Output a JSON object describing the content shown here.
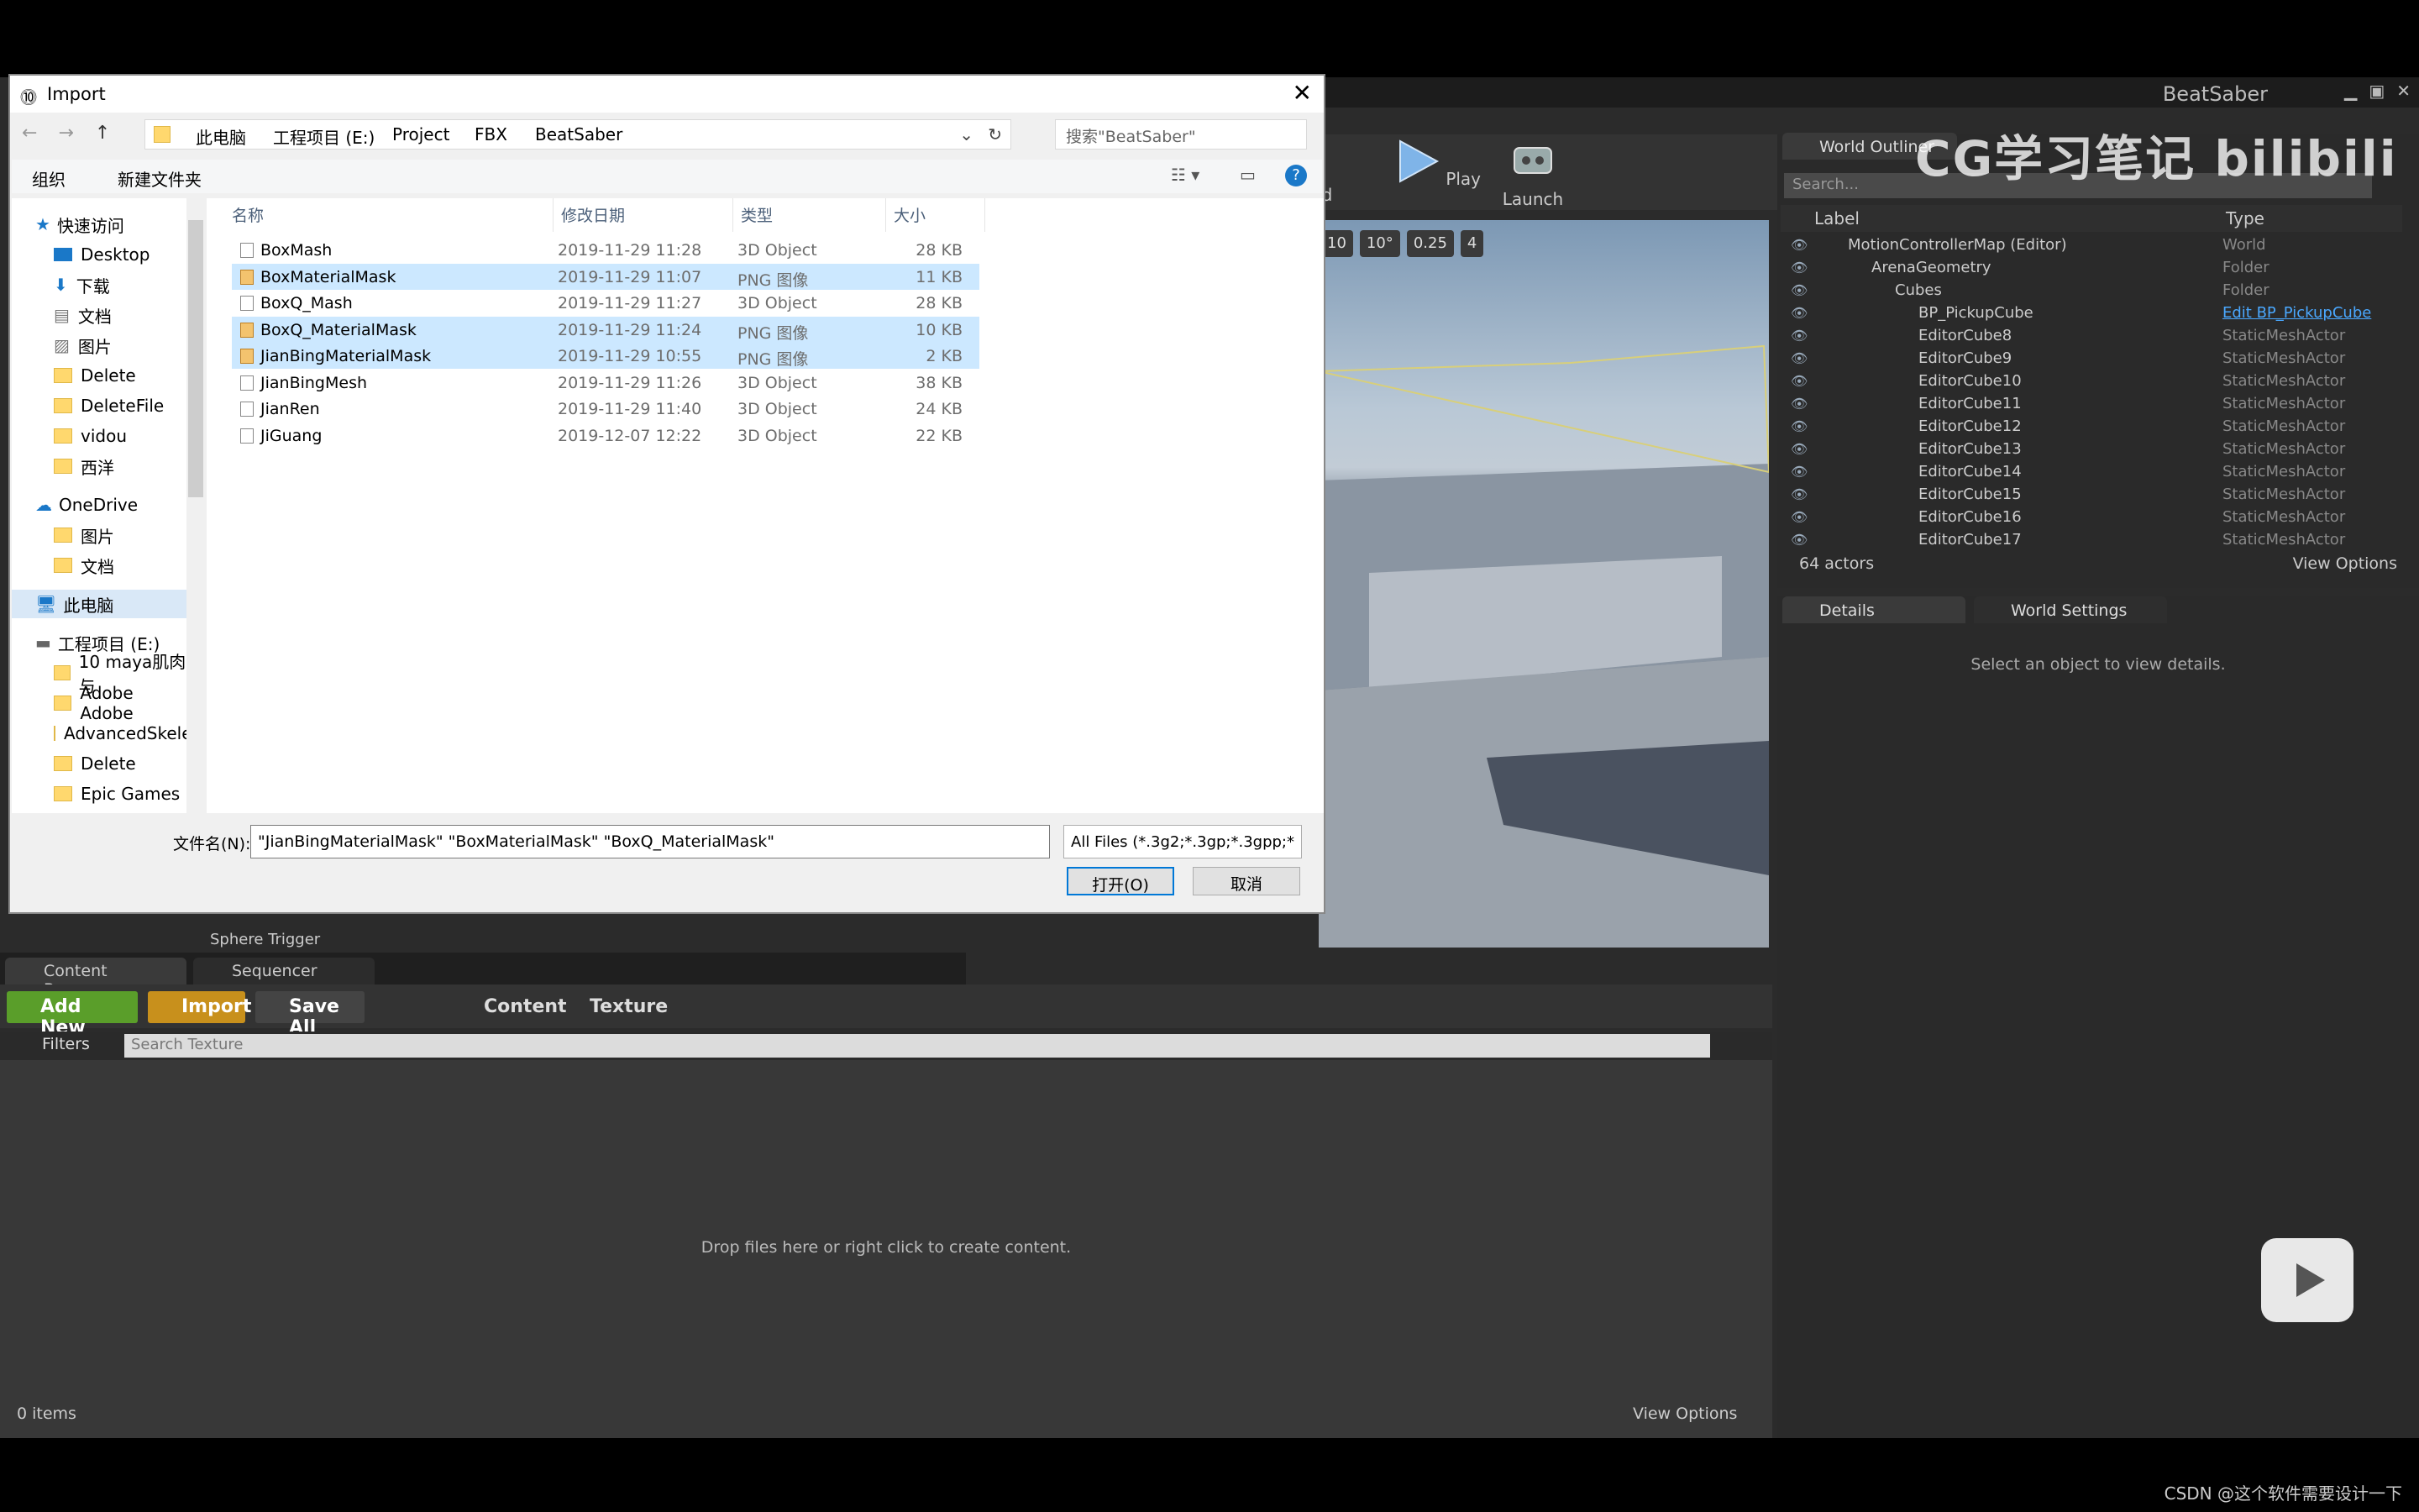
{
  "ue": {
    "project": "BeatSaber",
    "toolbar": {
      "play": "Play",
      "launch": "Launch",
      "partial": "d"
    },
    "viewport_chips": [
      "10",
      "10°",
      "0.25",
      "4"
    ],
    "outliner": {
      "tab": "World Outliner",
      "search_placeholder": "Search...",
      "col_label": "Label",
      "col_type": "Type",
      "rows": [
        {
          "label": "MotionControllerMap (Editor)",
          "type": "World",
          "indent": 0
        },
        {
          "label": "ArenaGeometry",
          "type": "Folder",
          "indent": 1
        },
        {
          "label": "Cubes",
          "type": "Folder",
          "indent": 2
        },
        {
          "label": "BP_PickupCube",
          "type": "Edit BP_PickupCube",
          "indent": 3,
          "link": true
        },
        {
          "label": "EditorCube8",
          "type": "StaticMeshActor",
          "indent": 3
        },
        {
          "label": "EditorCube9",
          "type": "StaticMeshActor",
          "indent": 3
        },
        {
          "label": "EditorCube10",
          "type": "StaticMeshActor",
          "indent": 3
        },
        {
          "label": "EditorCube11",
          "type": "StaticMeshActor",
          "indent": 3
        },
        {
          "label": "EditorCube12",
          "type": "StaticMeshActor",
          "indent": 3
        },
        {
          "label": "EditorCube13",
          "type": "StaticMeshActor",
          "indent": 3
        },
        {
          "label": "EditorCube14",
          "type": "StaticMeshActor",
          "indent": 3
        },
        {
          "label": "EditorCube15",
          "type": "StaticMeshActor",
          "indent": 3
        },
        {
          "label": "EditorCube16",
          "type": "StaticMeshActor",
          "indent": 3
        },
        {
          "label": "EditorCube17",
          "type": "StaticMeshActor",
          "indent": 3
        }
      ],
      "actor_count": "64 actors",
      "view_options": "View Options"
    },
    "details": {
      "tab": "Details",
      "tab2": "World Settings",
      "empty": "Select an object to view details."
    },
    "content_browser": {
      "tab": "Content Browser",
      "tab2": "Sequencer",
      "add_new": "Add New",
      "import": "Import",
      "save_all": "Save All",
      "crumbs": [
        "Content",
        "Texture"
      ],
      "filters": "Filters",
      "search_placeholder": "Search Texture",
      "drop_text": "Drop files here or right click to create content.",
      "items": "0 items",
      "view_options": "View Options",
      "partial_asset": "Sphere Trigger"
    }
  },
  "dialog": {
    "title": "Import",
    "path": [
      "此电脑",
      "工程项目 (E:)",
      "Project",
      "FBX",
      "BeatSaber"
    ],
    "search_placeholder": "搜索\"BeatSaber\"",
    "organize": "组织",
    "new_folder": "新建文件夹",
    "nav": [
      {
        "label": "快速访问",
        "type": "star"
      },
      {
        "label": "Desktop",
        "type": "desk"
      },
      {
        "label": "下载",
        "type": "down"
      },
      {
        "label": "文档",
        "type": "doc"
      },
      {
        "label": "图片",
        "type": "pic"
      },
      {
        "label": "Delete",
        "type": "folder"
      },
      {
        "label": "DeleteFile",
        "type": "folder"
      },
      {
        "label": "vidou",
        "type": "folder"
      },
      {
        "label": "西洋",
        "type": "folder"
      },
      {
        "label": "OneDrive",
        "type": "cloud"
      },
      {
        "label": "图片",
        "type": "folder"
      },
      {
        "label": "文档",
        "type": "folder"
      },
      {
        "label": "此电脑",
        "type": "pc"
      },
      {
        "label": "工程项目 (E:)",
        "type": "drive"
      },
      {
        "label": "10 maya肌肉与",
        "type": "folder"
      },
      {
        "label": "Adobe Adobe",
        "type": "folder"
      },
      {
        "label": "AdvancedSkele",
        "type": "folder"
      },
      {
        "label": "Delete",
        "type": "folder"
      },
      {
        "label": "Epic Games",
        "type": "folder"
      }
    ],
    "columns": {
      "name": "名称",
      "date": "修改日期",
      "type": "类型",
      "size": "大小"
    },
    "files": [
      {
        "name": "BoxMash",
        "date": "2019-11-29 11:28",
        "type": "3D Object",
        "size": "28 KB",
        "png": false,
        "selected": false
      },
      {
        "name": "BoxMaterialMask",
        "date": "2019-11-29 11:07",
        "type": "PNG 图像",
        "size": "11 KB",
        "png": true,
        "selected": true
      },
      {
        "name": "BoxQ_Mash",
        "date": "2019-11-29 11:27",
        "type": "3D Object",
        "size": "28 KB",
        "png": false,
        "selected": false
      },
      {
        "name": "BoxQ_MaterialMask",
        "date": "2019-11-29 11:24",
        "type": "PNG 图像",
        "size": "10 KB",
        "png": true,
        "selected": true
      },
      {
        "name": "JianBingMaterialMask",
        "date": "2019-11-29 10:55",
        "type": "PNG 图像",
        "size": "2 KB",
        "png": true,
        "selected": true
      },
      {
        "name": "JianBingMesh",
        "date": "2019-11-29 11:26",
        "type": "3D Object",
        "size": "38 KB",
        "png": false,
        "selected": false
      },
      {
        "name": "JianRen",
        "date": "2019-11-29 11:40",
        "type": "3D Object",
        "size": "24 KB",
        "png": false,
        "selected": false
      },
      {
        "name": "JiGuang",
        "date": "2019-12-07 12:22",
        "type": "3D Object",
        "size": "22 KB",
        "png": false,
        "selected": false
      }
    ],
    "filename_label": "文件名(N):",
    "filename_value": "\"JianBingMaterialMask\" \"BoxMaterialMask\" \"BoxQ_MaterialMask\"",
    "filetype": "All Files (*.3g2;*.3gp;*.3gpp;*",
    "open": "打开(O)",
    "cancel": "取消"
  },
  "overlay": {
    "watermark": "CG学习笔记 bilibili",
    "csdn": "CSDN @这个软件需要设计一下"
  }
}
